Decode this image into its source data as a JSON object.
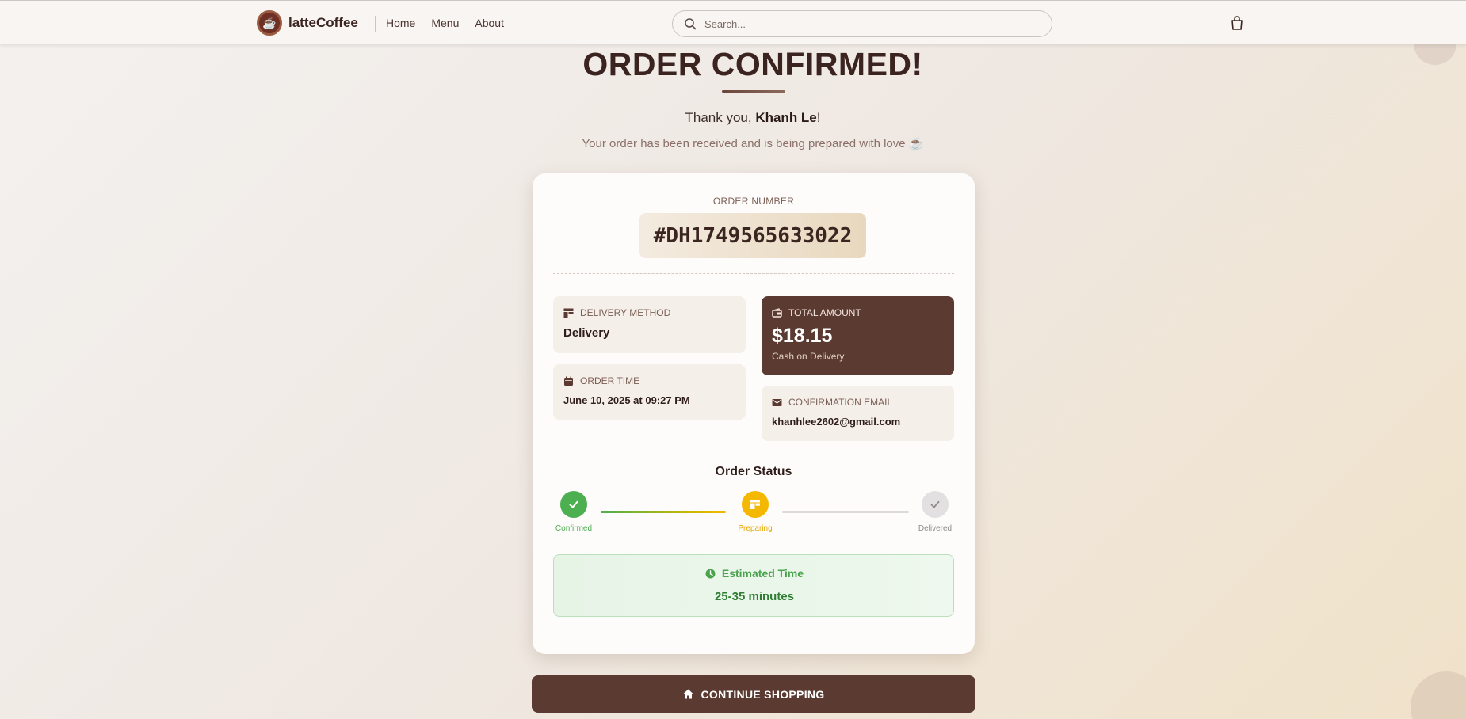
{
  "brand": {
    "name": "latteCoffee"
  },
  "nav": {
    "items": [
      "Home",
      "Menu",
      "About"
    ]
  },
  "search": {
    "placeholder": "Search...",
    "value": ""
  },
  "header": {
    "title": "ORDER CONFIRMED!",
    "thanks_prefix": "Thank you, ",
    "customer_name": "Khanh Le",
    "thanks_suffix": "!",
    "subtitle": "Your order has been received and is being prepared with love ☕"
  },
  "order": {
    "number_label": "ORDER NUMBER",
    "number": "#DH1749565633022",
    "delivery_method_label": "DELIVERY METHOD",
    "delivery_method": "Delivery",
    "order_time_label": "ORDER TIME",
    "order_time": "June 10, 2025 at 09:27 PM",
    "total_label": "TOTAL AMOUNT",
    "total": "$18.15",
    "payment": "Cash on Delivery",
    "email_label": "CONFIRMATION EMAIL",
    "email": "khanhlee2602@gmail.com"
  },
  "status": {
    "title": "Order Status",
    "steps": [
      {
        "label": "Confirmed",
        "state": "done",
        "color": "#4caf50"
      },
      {
        "label": "Preparing",
        "state": "current",
        "color": "#f5b800"
      },
      {
        "label": "Delivered",
        "state": "pending",
        "color": "#e2e0e0"
      }
    ]
  },
  "eta": {
    "label": "Estimated Time",
    "value": "25-35 minutes"
  },
  "actions": {
    "continue_label": "CONTINUE SHOPPING"
  },
  "colors": {
    "primary": "#5a3a31",
    "success": "#4caf50",
    "warning": "#f5b800"
  },
  "icons": [
    "coffee-logo-icon",
    "search-icon",
    "cart-icon",
    "store-icon",
    "wallet-icon",
    "calendar-icon",
    "mail-icon",
    "check-icon",
    "clock-icon",
    "home-icon"
  ]
}
